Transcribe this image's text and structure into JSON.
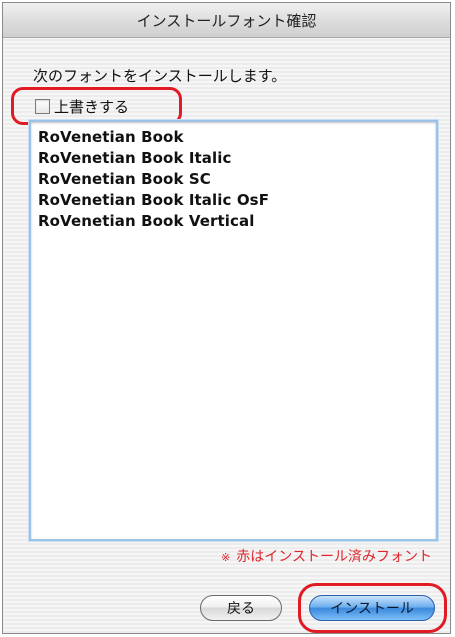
{
  "window": {
    "title": "インストールフォント確認"
  },
  "dialog": {
    "message": "次のフォントをインストールします。",
    "overwrite_label": "上書きする",
    "overwrite_checked": false,
    "fonts": [
      "RoVenetian Book",
      "RoVenetian Book Italic",
      "RoVenetian Book SC",
      "RoVenetian Book Italic OsF",
      "RoVenetian Book Vertical"
    ],
    "legend_mark": "※",
    "legend_text": "赤はインストール済みフォント"
  },
  "buttons": {
    "back_label": "戻る",
    "install_label": "インストール"
  },
  "colors": {
    "highlight_red": "#e01b23",
    "legend_red": "#e0242c",
    "install_blue": "#3c89dc"
  }
}
